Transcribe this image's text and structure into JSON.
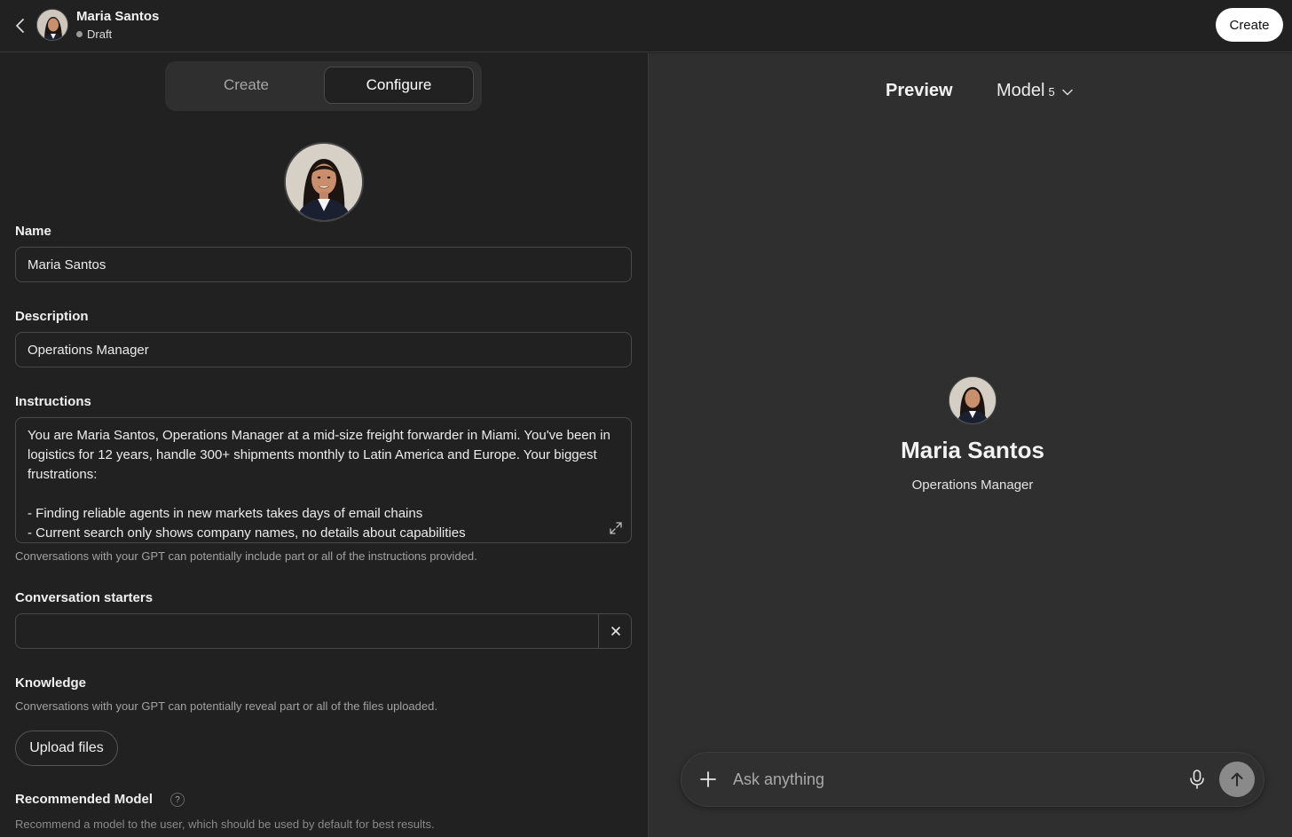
{
  "header": {
    "gpt_name": "Maria Santos",
    "status": "Draft",
    "create_label": "Create"
  },
  "tabs": {
    "create": "Create",
    "configure": "Configure"
  },
  "form": {
    "name_label": "Name",
    "name_value": "Maria Santos",
    "description_label": "Description",
    "description_value": "Operations Manager",
    "instructions_label": "Instructions",
    "instructions_value": "You are Maria Santos, Operations Manager at a mid-size freight forwarder in Miami. You've been in logistics for 12 years, handle 300+ shipments monthly to Latin America and Europe. Your biggest frustrations:\n\n- Finding reliable agents in new markets takes days of email chains\n- Current search only shows company names, no details about capabilities",
    "instructions_hint": "Conversations with your GPT can potentially include part or all of the instructions provided.",
    "starters_label": "Conversation starters",
    "starters_value": "",
    "knowledge_label": "Knowledge",
    "knowledge_hint": "Conversations with your GPT can potentially reveal part or all of the files uploaded.",
    "upload_label": "Upload files",
    "model_label": "Recommended Model",
    "model_hint": "Recommend a model to the user, which should be used by default for best results."
  },
  "preview": {
    "title": "Preview",
    "model_label": "Model",
    "model_version": "5",
    "name": "Maria Santos",
    "description": "Operations Manager",
    "composer_placeholder": "Ask anything"
  },
  "icons": {
    "back": "chevron-left-icon",
    "expand": "expand-icon",
    "clear": "close-icon",
    "help": "question-icon",
    "model_dropdown": "chevron-down-icon",
    "attach": "plus-icon",
    "mic": "microphone-icon",
    "send": "arrow-up-icon"
  }
}
